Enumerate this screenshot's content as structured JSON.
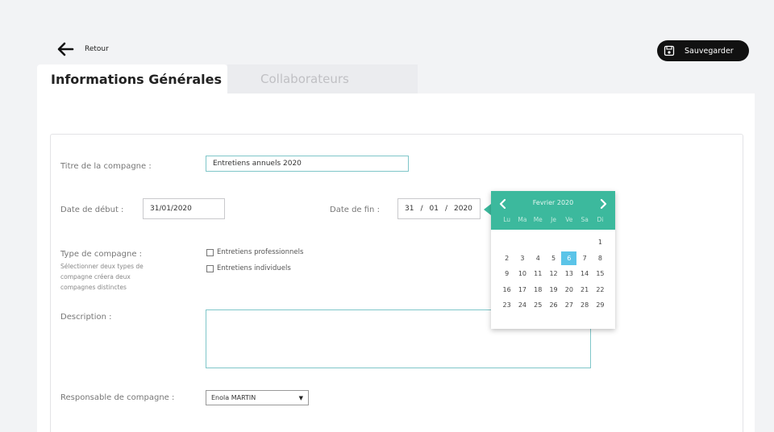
{
  "header": {
    "back_label": "Retour",
    "save_label": "Sauvegarder"
  },
  "tabs": [
    {
      "label": "Informations Générales",
      "active": true
    },
    {
      "label": "Collaborateurs",
      "active": false
    }
  ],
  "form": {
    "title_label": "Titre de la compagne :",
    "title_value": "Entretiens annuels 2020",
    "start_label": "Date de début :",
    "start_value": "31/01/2020",
    "end_label": "Date de fin :",
    "end_day": "31",
    "end_month": "01",
    "end_year": "2020",
    "end_sep": "/",
    "type_label": "Type de compagne :",
    "type_hint": "Sélectionner deux types de compagne créera deux compagnes distinctes",
    "type_options": [
      {
        "label": "Entretiens professionnels",
        "checked": false
      },
      {
        "label": "Entretiens individuels",
        "checked": false
      }
    ],
    "description_label": "Description :",
    "description_value": "",
    "manager_label": "Responsable de compagne :",
    "manager_value": "Enola MARTIN"
  },
  "calendar": {
    "month_label": "Fevrier 2020",
    "weekdays": [
      "Lu",
      "Ma",
      "Me",
      "Je",
      "Ve",
      "Sa",
      "Di"
    ],
    "weeks": [
      [
        "",
        "",
        "",
        "",
        "",
        "",
        "1"
      ],
      [
        "2",
        "3",
        "4",
        "5",
        "6",
        "7",
        "8"
      ],
      [
        "9",
        "10",
        "11",
        "12",
        "13",
        "14",
        "15"
      ],
      [
        "16",
        "17",
        "18",
        "19",
        "20",
        "21",
        "22"
      ],
      [
        "23",
        "24",
        "25",
        "26",
        "27",
        "28",
        "29"
      ]
    ],
    "selected": "6"
  },
  "colors": {
    "accent": "#3cb99d",
    "selected_day": "#5bc4e8",
    "field_focus": "#7fc6c9"
  }
}
